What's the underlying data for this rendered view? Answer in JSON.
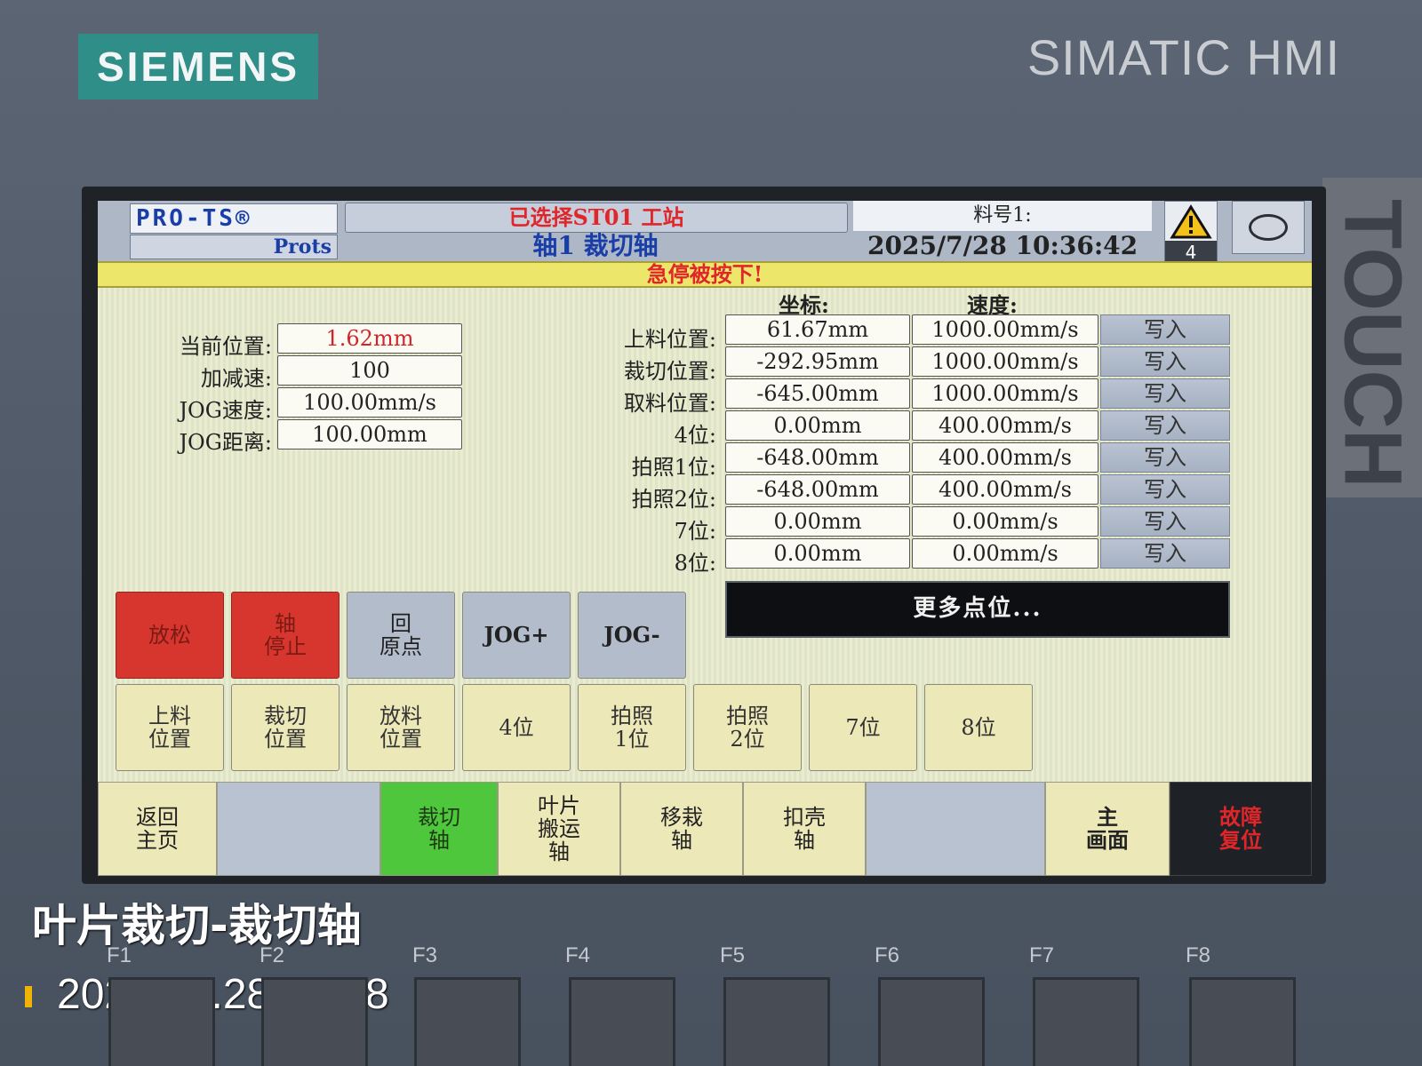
{
  "device": {
    "brand": "SIEMENS",
    "model": "SIMATIC HMI",
    "touch_label": "TOUCH"
  },
  "header": {
    "logo": "PRO-TS®",
    "sub_logo": "Prots",
    "station": "已选择ST01 工站",
    "axis_title": "轴1 裁切轴",
    "material_label": "料号1:",
    "datetime": "2025/7/28 10:36:42",
    "alarm_count": "4",
    "alarm_icon": "warning-icon",
    "circle_icon": "circle-icon"
  },
  "estop_banner": "急停被按下!",
  "params": [
    {
      "label": "当前位置:",
      "value": "1.62mm"
    },
    {
      "label": "加减速:",
      "value": "100"
    },
    {
      "label": "JOG速度:",
      "value": "100.00mm/s"
    },
    {
      "label": "JOG距离:",
      "value": "100.00mm"
    }
  ],
  "positions": {
    "coord_header": "坐标:",
    "speed_header": "速度:",
    "write_label": "写入",
    "rows": [
      {
        "label": "上料位置:",
        "coord": "61.67mm",
        "speed": "1000.00mm/s"
      },
      {
        "label": "裁切位置:",
        "coord": "-292.95mm",
        "speed": "1000.00mm/s"
      },
      {
        "label": "取料位置:",
        "coord": "-645.00mm",
        "speed": "1000.00mm/s"
      },
      {
        "label": "4位:",
        "coord": "0.00mm",
        "speed": "400.00mm/s"
      },
      {
        "label": "拍照1位:",
        "coord": "-648.00mm",
        "speed": "400.00mm/s"
      },
      {
        "label": "拍照2位:",
        "coord": "-648.00mm",
        "speed": "400.00mm/s"
      },
      {
        "label": "7位:",
        "coord": "0.00mm",
        "speed": "0.00mm/s"
      },
      {
        "label": "8位:",
        "coord": "0.00mm",
        "speed": "0.00mm/s"
      }
    ],
    "more_button": "更多点位..."
  },
  "control_buttons": {
    "release": "放松",
    "axis_stop": "轴\n停止",
    "home": "回\n原点",
    "jog_plus": "JOG+",
    "jog_minus": "JOG-"
  },
  "goto_buttons": {
    "load": "上料\n位置",
    "cut": "裁切\n位置",
    "unload": "放料\n位置",
    "p4": "4位",
    "photo1": "拍照\n1位",
    "photo2": "拍照\n2位",
    "p7": "7位",
    "p8": "8位"
  },
  "nav": {
    "back_home": "返回\n主页",
    "cut_axis": "裁切\n轴",
    "blade_transfer_axis": "叶片\n搬运\n轴",
    "move_axis": "移栽\n轴",
    "shell_axis": "扣壳\n轴",
    "main_screen": "主\n画面",
    "fault_reset": "故障\n复位"
  },
  "overlay": {
    "caption": "叶片裁切-裁切轴",
    "timestamp": "2025.07.28 08:38"
  },
  "function_keys": [
    "F1",
    "F2",
    "F3",
    "F4",
    "F5",
    "F6",
    "F7",
    "F8"
  ],
  "colors": {
    "emergency_red": "#e0262a",
    "active_green": "#4fc73c",
    "title_blue": "#1a3ea8",
    "banner_yellow": "#ece66a"
  }
}
